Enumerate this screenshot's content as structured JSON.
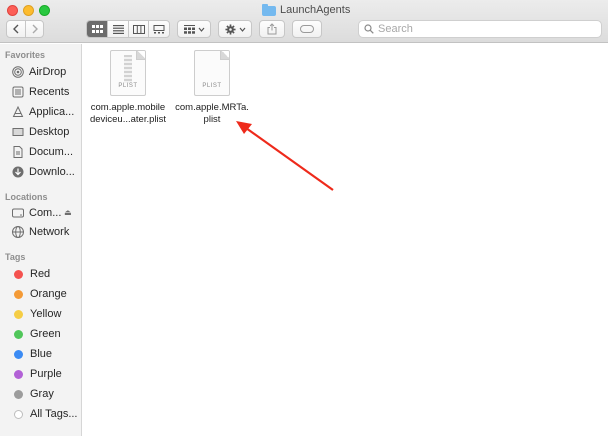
{
  "window": {
    "title": "LaunchAgents"
  },
  "toolbar": {
    "search_placeholder": "Search"
  },
  "sidebar": {
    "favorites_header": "Favorites",
    "favorites": [
      {
        "label": "AirDrop",
        "icon": "airdrop-icon"
      },
      {
        "label": "Recents",
        "icon": "recents-icon"
      },
      {
        "label": "Applica...",
        "icon": "applications-icon"
      },
      {
        "label": "Desktop",
        "icon": "desktop-icon"
      },
      {
        "label": "Docum...",
        "icon": "documents-icon"
      },
      {
        "label": "Downlo...",
        "icon": "downloads-icon"
      }
    ],
    "locations_header": "Locations",
    "locations": [
      {
        "label": "Com...",
        "icon": "disk-icon"
      },
      {
        "label": "Network",
        "icon": "network-icon"
      }
    ],
    "tags_header": "Tags",
    "tags": [
      {
        "label": "Red",
        "color": "#f4524f"
      },
      {
        "label": "Orange",
        "color": "#f39a36"
      },
      {
        "label": "Yellow",
        "color": "#f5cd45"
      },
      {
        "label": "Green",
        "color": "#50c65a"
      },
      {
        "label": "Blue",
        "color": "#3b8bf3"
      },
      {
        "label": "Purple",
        "color": "#b261d6"
      },
      {
        "label": "Gray",
        "color": "#9c9c9c"
      },
      {
        "label": "All Tags...",
        "color": "#d9d9d9"
      }
    ]
  },
  "files": [
    {
      "icon_label": "PLIST",
      "name_line1": "com.apple.mobile",
      "name_line2": "deviceu...ater.plist"
    },
    {
      "icon_label": "PLIST",
      "name_line1": "com.apple.MRTa.",
      "name_line2": "plist"
    }
  ],
  "annotation": {
    "color": "#ee2a1b"
  }
}
